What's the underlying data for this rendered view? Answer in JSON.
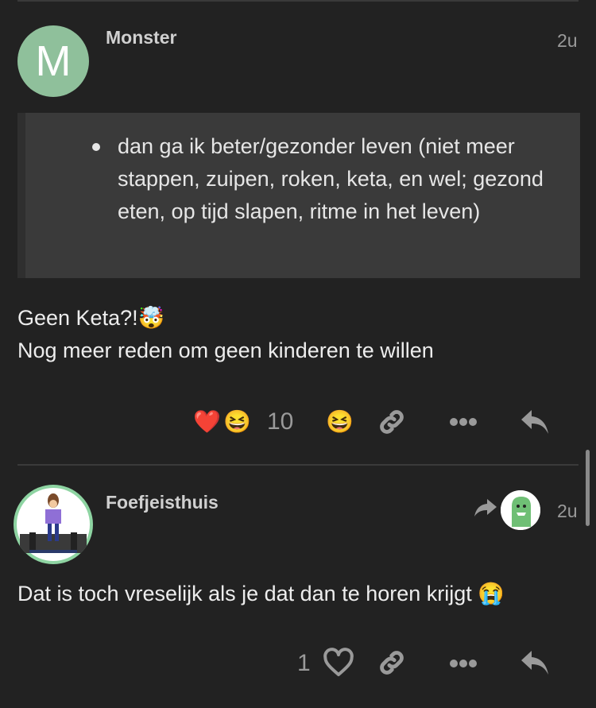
{
  "posts": [
    {
      "avatar_letter": "M",
      "username": "Monster",
      "time": "2u",
      "quote": {
        "items": [
          "dan ga ik beter/gezonder leven (niet meer stappen, zuipen, roken, keta, en wel; gezond eten, op tijd slapen, ritme in het leven)"
        ]
      },
      "body": {
        "line1": "Geen Keta?!",
        "line1_emoji": "🤯",
        "line2": "Nog meer reden om geen kinderen te willen"
      },
      "reactions": {
        "emojis": [
          "❤️",
          "😆"
        ],
        "count": "10",
        "add_reaction_emoji": "😆"
      }
    },
    {
      "username": "Foefjeisthuis",
      "time": "2u",
      "body": {
        "text": "Dat is toch vreselijk als je dat dan te horen krijgt",
        "emoji": "😭"
      },
      "like_count": "1"
    }
  ],
  "colors": {
    "background": "#222222",
    "text": "#ededed",
    "muted": "#9a9a9a",
    "quote_bg": "#3a3a3a",
    "avatar_m": "#8fc09b",
    "avatar_ring": "#8ed4a2"
  },
  "icons": [
    "link-icon",
    "more-icon",
    "reply-icon",
    "heart-icon",
    "reply-arrow-icon"
  ]
}
